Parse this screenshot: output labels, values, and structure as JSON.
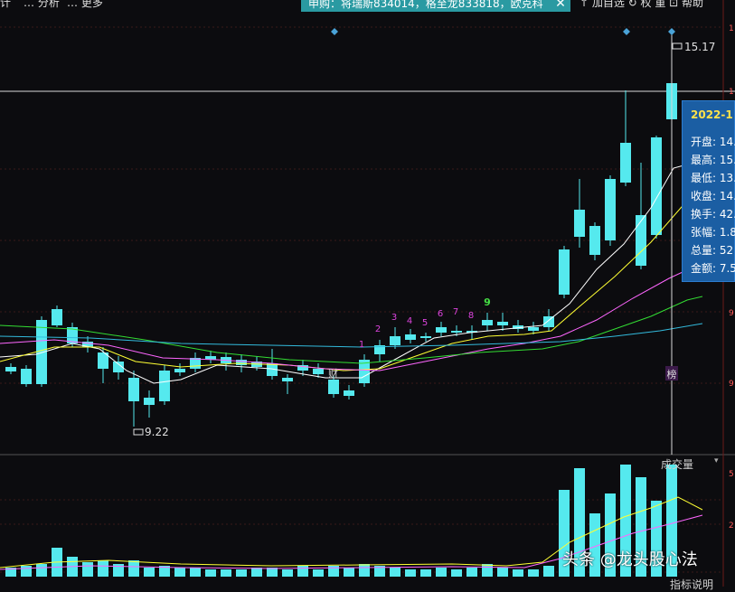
{
  "toolbar": {
    "item1": "计",
    "item2": "… 分析",
    "item3": "… 更多",
    "right_items": "↑ 加自选  ↻  权  重  ⊡  帮助"
  },
  "banner": {
    "text": "申购：将瑞斯834014，格至龙833818，欧克科",
    "close": "✕"
  },
  "tooltip": {
    "date": "2022-1",
    "rows": [
      {
        "label": "开盘:",
        "value": "14."
      },
      {
        "label": "最高:",
        "value": "15."
      },
      {
        "label": "最低:",
        "value": "13."
      },
      {
        "label": "收盘:",
        "value": "14."
      },
      {
        "label": "换手:",
        "value": "42."
      },
      {
        "label": "张幅:",
        "value": "1.8"
      },
      {
        "label": "总量:",
        "value": "52"
      },
      {
        "label": "金额:",
        "value": "7.5"
      }
    ]
  },
  "price_labels": {
    "max": "15.17",
    "min": "9.22"
  },
  "markers": {
    "sequence": [
      "1",
      "2",
      "3",
      "4",
      "5",
      "6",
      "7",
      "8",
      "9"
    ],
    "cai": "财",
    "bang": "榜"
  },
  "axis_labels": {
    "right1": "1",
    "right2": "1",
    "right3": "9",
    "right4": "9",
    "vol1": "5",
    "vol2": "2"
  },
  "volume": {
    "label": "成交量",
    "arrow": "▾"
  },
  "bottom_tab": "指标说明",
  "watermark": "头条 @龙头股心法",
  "colors": {
    "up": "#ff3b3b",
    "down": "#55e9ee",
    "bg": "#0c0c0f"
  }
}
